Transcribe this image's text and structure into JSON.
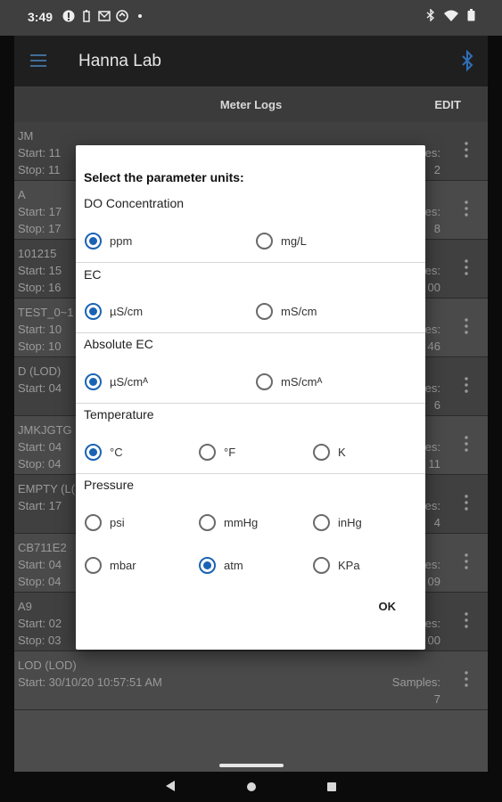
{
  "status_bar": {
    "time": "3:49"
  },
  "app_bar": {
    "title": "Hanna Lab"
  },
  "sub_bar": {
    "title": "Meter Logs",
    "edit_label": "EDIT"
  },
  "logs": [
    {
      "name": "JM",
      "line1": "Start:  11",
      "line2": "Stop:  11",
      "right1": "es:",
      "right2": "2"
    },
    {
      "name": "A",
      "line1": "Start:  17",
      "line2": "Stop:  17",
      "right1": "es:",
      "right2": "8"
    },
    {
      "name": "101215",
      "line1": "Start:  15",
      "line2": "Stop:  16",
      "right1": "es:",
      "right2": "00"
    },
    {
      "name": "TEST_0~1",
      "line1": "Start:  10",
      "line2": "Stop:  10",
      "right1": "es:",
      "right2": "46"
    },
    {
      "name": "D (LOD)",
      "line1": "Start:  04",
      "line2": "",
      "right1": "es:",
      "right2": "6"
    },
    {
      "name": "JMKJGTG",
      "line1": "Start:  04",
      "line2": "Stop:  04",
      "right1": "es:",
      "right2": "11"
    },
    {
      "name": "EMPTY (L(",
      "line1": "Start:  17",
      "line2": "",
      "right1": "es:",
      "right2": "4"
    },
    {
      "name": "CB711E2",
      "line1": "Start:  04",
      "line2": "Stop:  04",
      "right1": "es:",
      "right2": "09"
    },
    {
      "name": "A9",
      "line1": "Start:  02",
      "line2": "Stop:  03",
      "right1": "es:",
      "right2": "00"
    },
    {
      "name": "LOD (LOD)",
      "line1": "Start:   30/10/20 10:57:51 AM",
      "line2": "",
      "right1": "Samples:",
      "right2": "7"
    }
  ],
  "dialog": {
    "title": "Select the parameter units:",
    "ok_label": "OK",
    "groups": [
      {
        "label": "DO Concentration",
        "options": [
          {
            "label": "ppm",
            "selected": true
          },
          {
            "label": "mg/L",
            "selected": false
          }
        ]
      },
      {
        "label": "EC",
        "options": [
          {
            "label": "µS/cm",
            "selected": true
          },
          {
            "label": "mS/cm",
            "selected": false
          }
        ]
      },
      {
        "label": "Absolute EC",
        "options": [
          {
            "label": "µS/cmᴬ",
            "selected": true
          },
          {
            "label": "mS/cmᴬ",
            "selected": false
          }
        ]
      },
      {
        "label": "Temperature",
        "options": [
          {
            "label": "°C",
            "selected": true
          },
          {
            "label": "°F",
            "selected": false
          },
          {
            "label": "K",
            "selected": false
          }
        ]
      },
      {
        "label": "Pressure",
        "options": [
          {
            "label": "psi",
            "selected": false
          },
          {
            "label": "mmHg",
            "selected": false
          },
          {
            "label": "inHg",
            "selected": false
          },
          {
            "label": "mbar",
            "selected": false
          },
          {
            "label": "atm",
            "selected": true
          },
          {
            "label": "KPa",
            "selected": false
          }
        ]
      }
    ]
  },
  "colors": {
    "accent": "#1a63b4",
    "dialog_bg": "#ffffff",
    "app_bar": "#1f1f1f"
  }
}
